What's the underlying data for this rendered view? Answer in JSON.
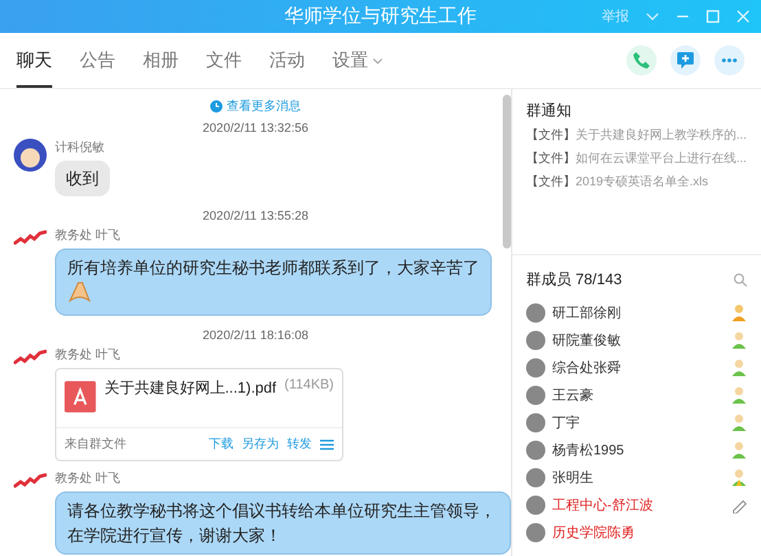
{
  "window": {
    "title": "华师学位与研究生工作",
    "report": "举报"
  },
  "tabs": [
    {
      "label": "聊天",
      "selected": true,
      "dropdown": false
    },
    {
      "label": "公告",
      "selected": false,
      "dropdown": false
    },
    {
      "label": "相册",
      "selected": false,
      "dropdown": false
    },
    {
      "label": "文件",
      "selected": false,
      "dropdown": false
    },
    {
      "label": "活动",
      "selected": false,
      "dropdown": false
    },
    {
      "label": "设置",
      "selected": false,
      "dropdown": true
    }
  ],
  "chat": {
    "more_link": "查看更多消息",
    "messages": [
      {
        "kind": "time",
        "text": "2020/2/11 13:32:56"
      },
      {
        "kind": "text",
        "sender": "计科倪敏",
        "text": "收到",
        "highlighted": false,
        "sticker": false
      },
      {
        "kind": "time",
        "text": "2020/2/11 13:55:28"
      },
      {
        "kind": "text",
        "sender": "教务处 叶飞",
        "text": "所有培养单位的研究生秘书老师都联系到了，大家辛苦了",
        "highlighted": true,
        "sticker": true
      },
      {
        "kind": "time",
        "text": "2020/2/11 18:16:08"
      },
      {
        "kind": "file",
        "sender": "教务处 叶飞",
        "file_name": "关于共建良好网上...1).pdf",
        "size": "(114KB)",
        "source": "来自群文件",
        "actions": [
          "下载",
          "另存为",
          "转发"
        ]
      },
      {
        "kind": "text",
        "sender": "教务处 叶飞",
        "text": "请各位教学秘书将这个倡议书转给本单位研究生主管领导，在学院进行宣传，谢谢大家！",
        "highlighted": true,
        "sticker": false
      }
    ]
  },
  "notice": {
    "title": "群通知",
    "items": [
      {
        "tag": "【文件】",
        "text": "关于共建良好网上教学秩序的..."
      },
      {
        "tag": "【文件】",
        "text": "如何在云课堂平台上进行在线..."
      },
      {
        "tag": "【文件】",
        "text": "2019专硕英语名单全.xls"
      }
    ]
  },
  "members": {
    "title": "群成员 78/143",
    "items": [
      {
        "name": "研工部徐刚",
        "kind": "owner",
        "color": "#333333"
      },
      {
        "name": "研院董俊敏",
        "kind": "admin",
        "color": "#333333"
      },
      {
        "name": "综合处张舜",
        "kind": "admin",
        "color": "#333333"
      },
      {
        "name": "王云豪",
        "kind": "admin",
        "color": "#333333"
      },
      {
        "name": "丁宇",
        "kind": "admin",
        "color": "#333333"
      },
      {
        "name": "杨青松1995",
        "kind": "admin",
        "color": "#333333"
      },
      {
        "name": "张明生",
        "kind": "vip",
        "color": "#333333"
      },
      {
        "name": "工程中心-舒江波",
        "kind": "editable",
        "color": "#e02020"
      },
      {
        "name": "历史学院陈勇",
        "kind": "plain",
        "color": "#e02020"
      }
    ]
  }
}
